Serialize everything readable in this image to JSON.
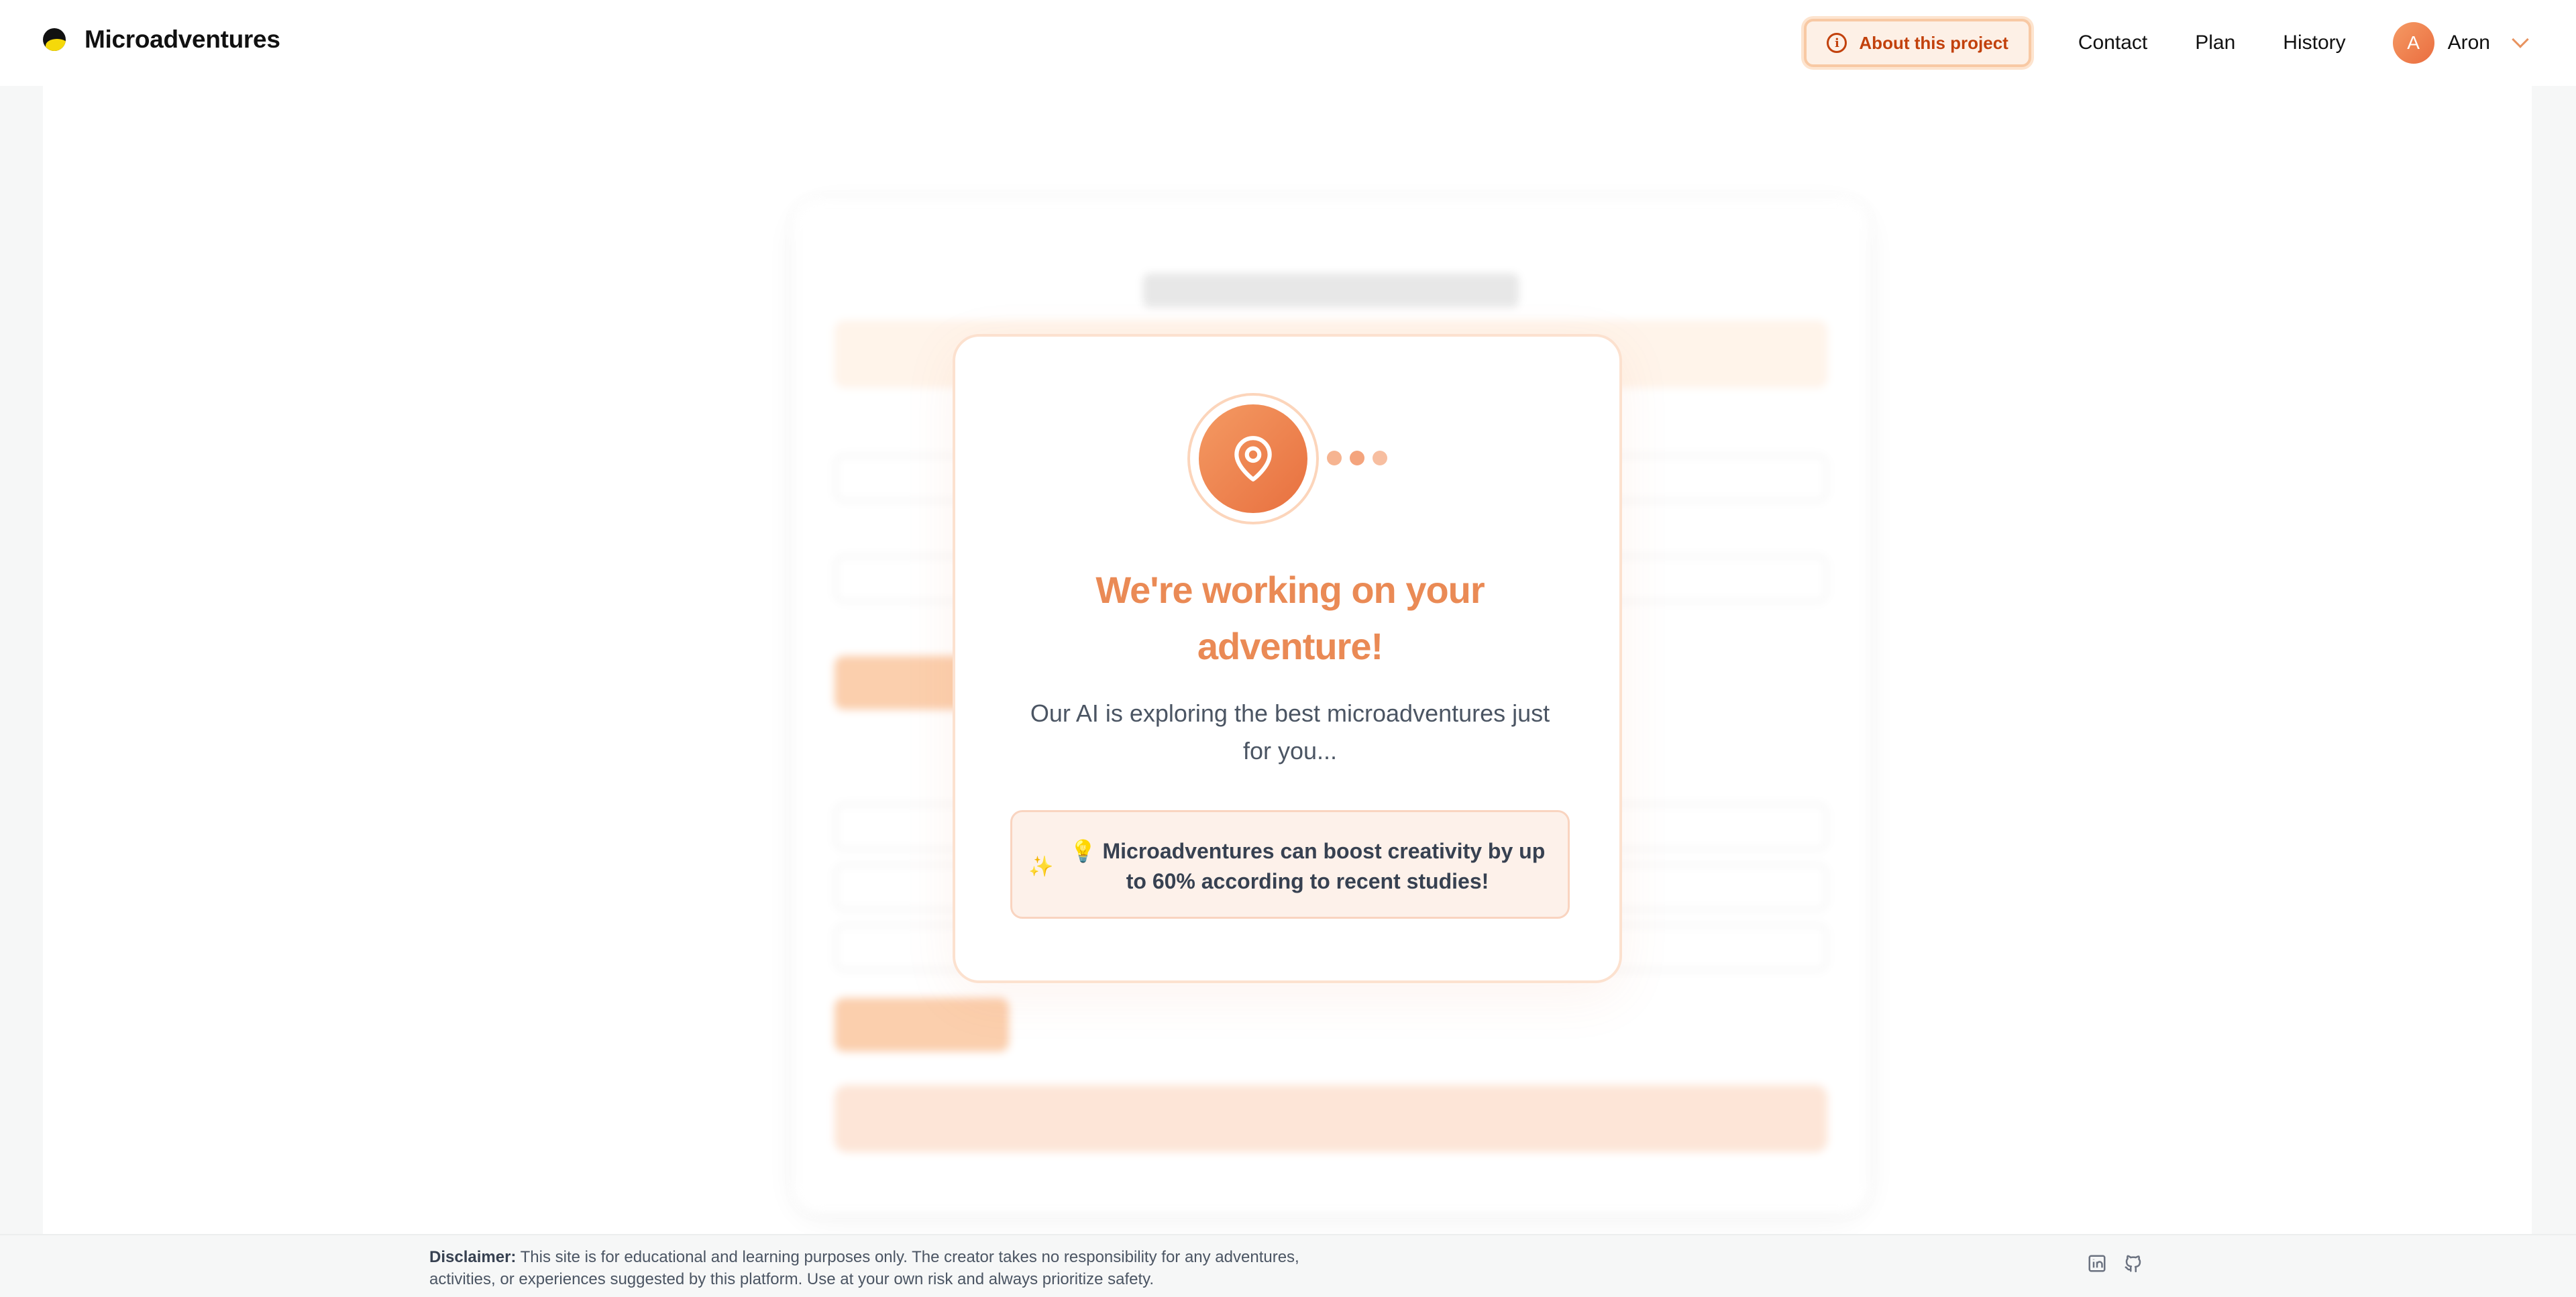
{
  "header": {
    "brand": "Microadventures",
    "about_label": "About this project",
    "nav": [
      "Contact",
      "Plan",
      "History"
    ],
    "user": {
      "initial": "A",
      "name": "Aron"
    }
  },
  "modal": {
    "title": "We're working on your adventure!",
    "subtitle": "Our AI is exploring the best microadventures just for you...",
    "fact": "Microadventures can boost creativity by up to 60% according to recent studies!",
    "sparkle_icon": "✨",
    "bulb_icon": "💡"
  },
  "footer": {
    "disclaimer_label": "Disclaimer:",
    "disclaimer_text": " This site is for educational and learning purposes only. The creator takes no responsibility for any adventures, activities, or experiences suggested by this platform. Use at your own risk and always prioritize safety.",
    "social": [
      "linkedin-icon",
      "github-icon"
    ]
  },
  "colors": {
    "accent": "#ea8a55",
    "accent_dark": "#c2410c",
    "fact_bg": "#fdf1ea"
  }
}
